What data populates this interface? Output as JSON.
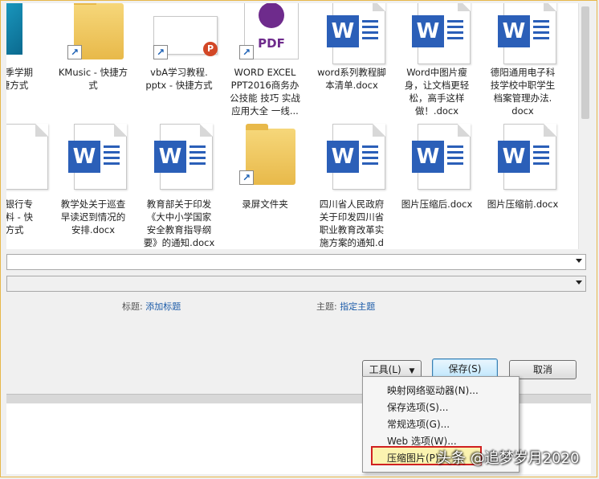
{
  "files": {
    "row1": [
      {
        "label": "秋季学期\n捷方式",
        "type": "app"
      },
      {
        "label": "KMusic - 快捷方\n式",
        "type": "folder-shortcut"
      },
      {
        "label": "vbA学习教程.\npptx - 快捷方式",
        "type": "pptx-shortcut"
      },
      {
        "label": "WORD EXCEL\nPPT2016商务办\n公技能 技巧 实战\n应用大全 一线...",
        "type": "pdf-shortcut",
        "badge": "PDF"
      },
      {
        "label": "word系列教程脚\n本清单.docx",
        "type": "docx"
      },
      {
        "label": "Word中图片瘦\n身，让文档更轻\n松，高手这样\n做！.docx",
        "type": "docx"
      },
      {
        "label": "德阳通用电子科\n技学校中职学生\n档案管理办法.\ndocx",
        "type": "docx"
      }
    ],
    "row2": [
      {
        "label": "分银行专\n材料 - 快\n方式",
        "type": "doc-partial"
      },
      {
        "label": "教学处关于巡查\n早读迟到情况的\n安排.docx",
        "type": "docx"
      },
      {
        "label": "教育部关于印发\n《大中小学国家\n安全教育指导纲\n要》的通知.docx",
        "type": "docx"
      },
      {
        "label": "录屏文件夹",
        "type": "folder-shortcut"
      },
      {
        "label": "四川省人民政府\n关于印发四川省\n职业教育改革实\n施方案的通知.d",
        "type": "docx"
      },
      {
        "label": "图片压缩后.docx",
        "type": "docx"
      },
      {
        "label": "图片压缩前.docx",
        "type": "docx"
      }
    ],
    "word_letter": "W"
  },
  "meta": {
    "title_key": "标题:",
    "title_val": "添加标题",
    "subject_key": "主题:",
    "subject_val": "指定主题"
  },
  "buttons": {
    "tools": "工具(L)",
    "save": "保存(S)",
    "cancel": "取消"
  },
  "menu": {
    "items": [
      "映射网络驱动器(N)...",
      "保存选项(S)...",
      "常规选项(G)...",
      "Web 选项(W)...",
      "压缩图片(P)..."
    ]
  },
  "watermark": "头条 @追梦岁月2020",
  "colors": {
    "word_blue": "#2b5fb8",
    "link": "#1a5aa8",
    "highlight_border": "#d02020"
  }
}
